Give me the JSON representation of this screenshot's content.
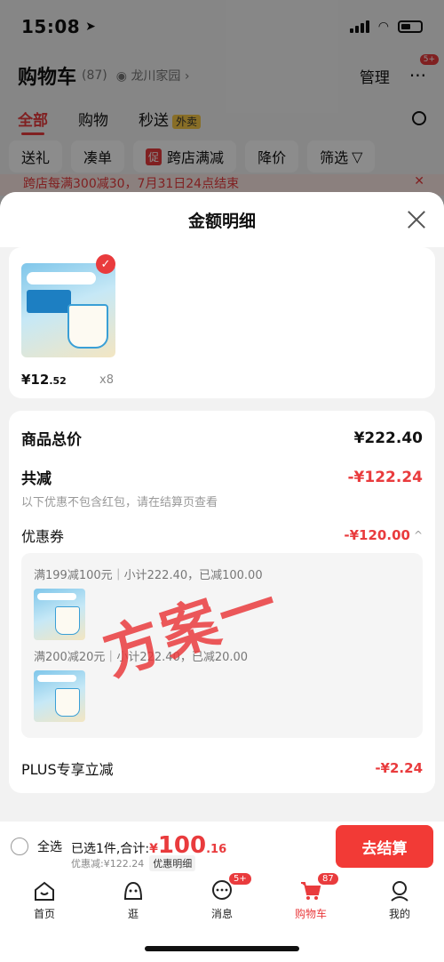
{
  "status_bar": {
    "time": "15:08"
  },
  "cart_header": {
    "title": "购物车",
    "count": "(87)",
    "location": "龙川家园",
    "manage": "管理",
    "more_badge": "5+"
  },
  "cart_tabs": [
    {
      "label": "全部"
    },
    {
      "label": "购物"
    },
    {
      "label": "秒送"
    }
  ],
  "waimai": "外卖",
  "filters": [
    "送礼",
    "凑单",
    "跨店满减",
    "降价",
    "筛选"
  ],
  "promo_tag": "促",
  "promo_strip": "跨店每满300减30，7月31日24点结束",
  "sheet": {
    "title": "金额明细",
    "product": {
      "price_int": "¥12",
      "price_dec": ".52",
      "qty": "x8"
    },
    "total": {
      "label": "商品总价",
      "value": "¥222.40"
    },
    "reduce": {
      "label": "共减",
      "value": "-¥122.24"
    },
    "note": "以下优惠不包含红包，请在结算页查看",
    "coupon": {
      "label": "优惠券",
      "value": "-¥120.00"
    },
    "coupon_lines": [
      "满199减100元｜小计222.40，已减100.00",
      "满200减20元｜小计222.40，已减20.00"
    ],
    "plus": {
      "label": "PLUS专享立减",
      "value": "-¥2.24"
    },
    "stamp": "方案一"
  },
  "checkout": {
    "select_all": "全选",
    "selected": "已选1件,合计:",
    "yen": "¥",
    "amount_int": "100",
    "amount_dec": ".16",
    "discount": "优惠减:¥122.24",
    "detail_tag": "优惠明细",
    "button": "去结算"
  },
  "tabbar": [
    {
      "label": "首页",
      "icon": "home-icon"
    },
    {
      "label": "逛",
      "icon": "browse-face-icon"
    },
    {
      "label": "消息",
      "icon": "message-icon",
      "badge": "5+"
    },
    {
      "label": "购物车",
      "icon": "cart-icon",
      "badge": "87"
    },
    {
      "label": "我的",
      "icon": "profile-icon"
    }
  ],
  "colors": {
    "accent": "#e93b3d",
    "button": "#f23a36"
  }
}
